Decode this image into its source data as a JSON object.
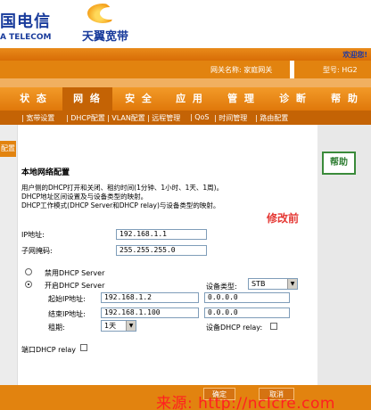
{
  "brand": {
    "telecom_cn": "国电信",
    "telecom_en": "A TELECOM",
    "tianyi": "天翼宽带"
  },
  "top": {
    "welcome": "欢迎您!",
    "gateway_name": "网关名称: 家庭网关",
    "model": "型号: HG2"
  },
  "nav": {
    "tabs": [
      "状 态",
      "网 络",
      "安 全",
      "应 用",
      "管 理",
      "诊 断",
      "帮 助"
    ],
    "active": "网 络"
  },
  "subnav": [
    "| 宽带设置",
    "| DHCP配置",
    "| VLAN配置",
    "| 远程管理",
    "| QoS",
    "| 时间管理",
    "| 路由配置"
  ],
  "side": {
    "tab": "配置"
  },
  "help": {
    "label": "帮助"
  },
  "content": {
    "title": "本地网络配置",
    "desc1": "用户侧的DHCP打开和关闭、租约时间(1分钟、1小时、1天、1周)。",
    "desc2": "DHCP地址区间设置及与设备类型的映射。",
    "desc3": "DHCP工作模式(DHCP Server和DHCP relay)与设备类型的映射。",
    "modified_note": "修改前",
    "ip_label": "IP地址:",
    "ip_value": "192.168.1.1",
    "mask_label": "子网掩码:",
    "mask_value": "255.255.255.0",
    "disable_dhcp": "禁用DHCP Server",
    "enable_dhcp": "开启DHCP Server",
    "start_ip_label": "起始IP地址:",
    "start_ip_value": "192.168.1.2",
    "end_ip_label": "结束IP地址:",
    "end_ip_value": "192.168.1.100",
    "lease_label": "租期:",
    "lease_value": "1天",
    "device_type_label": "设备类型:",
    "device_type_value": "STB",
    "dev_start_ip": "0.0.0.0",
    "dev_end_ip": "0.0.0.0",
    "device_relay_label": "设备DHCP relay:",
    "port_relay_label": "端口DHCP relay"
  },
  "footer": {
    "ok": "确定",
    "cancel": "取消",
    "watermark": "来源: http://ncIcre.com"
  },
  "colors": {
    "accent": "#e2830f",
    "active_tab": "#c46305",
    "brand_blue": "#1a3c9c",
    "help_green": "#2e7d32",
    "note_red": "#e53935"
  }
}
